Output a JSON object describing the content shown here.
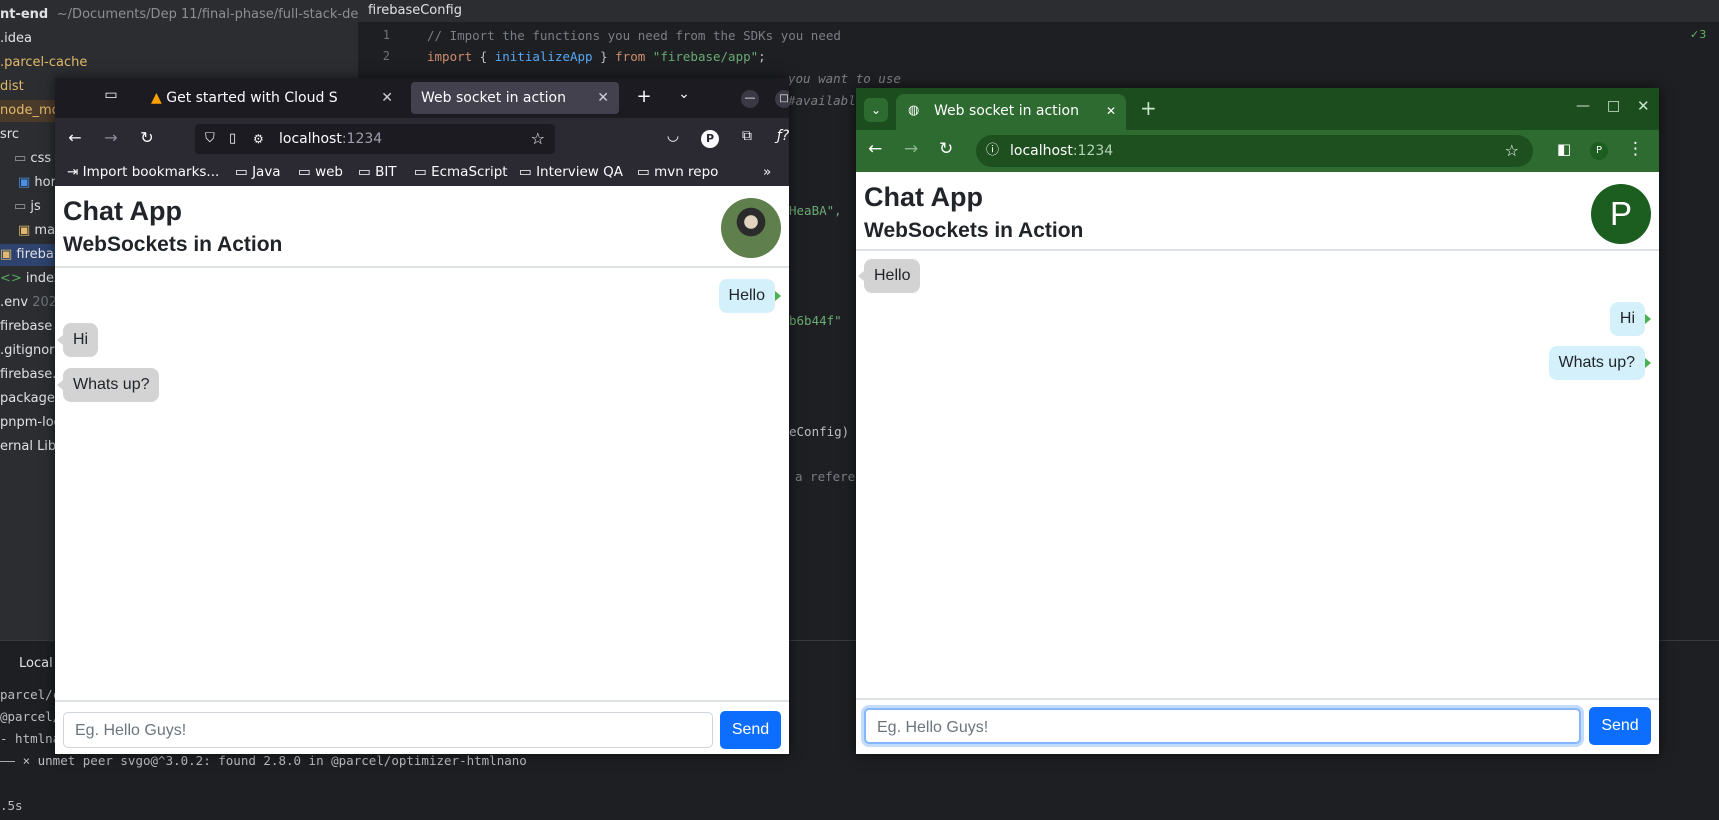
{
  "ide": {
    "project_header": "nt-end",
    "project_path": "~/Documents/Dep 11/final-phase/full-stack-develo",
    "tree": [
      ".idea",
      ".parcel-cache",
      "dist",
      "node_mo",
      "src",
      "css",
      "hor",
      "js",
      "ma",
      "fireba",
      "index.",
      ".env",
      "firebase",
      ".gitignore",
      "firebase.j",
      "package.",
      "pnpm-loc",
      "ernal Libr"
    ],
    "env_suffix": "202",
    "editor_tab": "firebaseConfig",
    "problems_count": "3",
    "code_lines": [
      {
        "num": "1",
        "text": "// Import the functions you need from the SDKs you need"
      },
      {
        "num": "2",
        "text_kw": "import",
        "text_p1": " { ",
        "text_fn": "initializeApp",
        "text_p2": " } ",
        "text_kw2": "from",
        "text_str": " \"firebase/app\"",
        "text_end": ";"
      }
    ],
    "code_fragments": [
      "you want to use",
      "#availabl",
      "HeaBA\",",
      "b6b44f\"",
      "eConfig)",
      "a refere"
    ],
    "bottom_tab": "Local",
    "terminal_lines": [
      "parcel/co",
      "@parcel/",
      "- htmlna",
      "—— × unmet peer svgo@^3.0.2: found 2.8.0 in @parcel/optimizer-htmlnano",
      ".5s"
    ]
  },
  "firefox": {
    "tabs": [
      {
        "label": "Get started with Cloud S"
      },
      {
        "label": "Web socket in action"
      }
    ],
    "url_host": "localhost",
    "url_port": ":1234",
    "bookmarks": [
      "Import bookmarks...",
      "Java",
      "web",
      "BIT",
      "EcmaScript",
      "Interview QA",
      "mvn repo"
    ],
    "profile_initial": "P"
  },
  "chrome": {
    "tab_label": "Web socket in action",
    "url_host": "localhost",
    "url_port": ":1234",
    "profile_initial": "P"
  },
  "chat_left": {
    "title": "Chat App",
    "subtitle": "WebSockets in Action",
    "messages": [
      {
        "side": "right",
        "text": "Hello"
      },
      {
        "side": "left",
        "text": "Hi"
      },
      {
        "side": "left",
        "text": "Whats up?"
      }
    ],
    "input_placeholder": "Eg. Hello Guys!",
    "send_label": "Send"
  },
  "chat_right": {
    "title": "Chat App",
    "subtitle": "WebSockets in Action",
    "avatar_initial": "P",
    "messages": [
      {
        "side": "left",
        "text": "Hello"
      },
      {
        "side": "right",
        "text": "Hi"
      },
      {
        "side": "right",
        "text": "Whats up?"
      }
    ],
    "input_placeholder": "Eg. Hello Guys!",
    "send_label": "Send"
  },
  "colors": {
    "ide_bg": "#1e1f22",
    "firefox_chrome": "#2b2a33",
    "chrome_green": "#2e6b30",
    "bootstrap_primary": "#0d6efd",
    "avatar_green": "#1b5e20"
  }
}
